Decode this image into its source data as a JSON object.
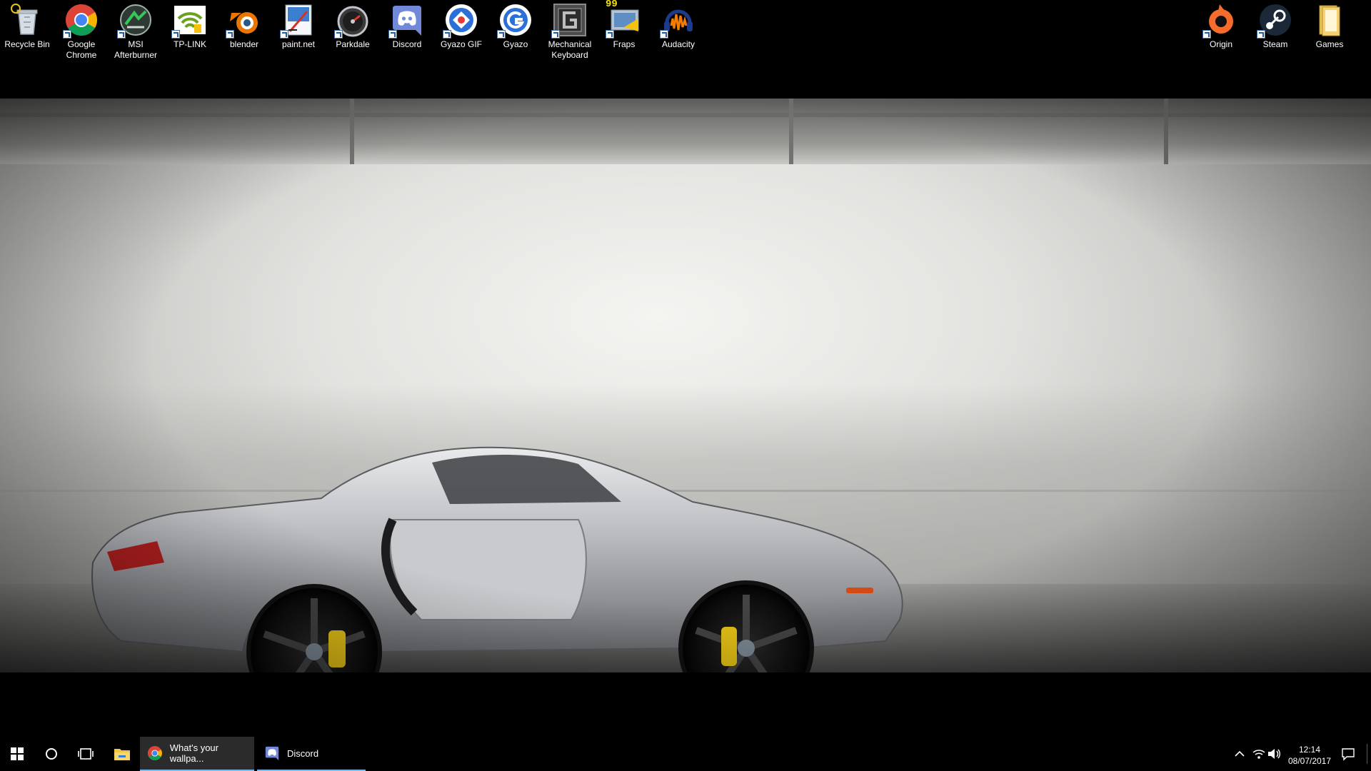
{
  "desktop_icons": [
    {
      "label": "Recycle Bin",
      "icon": "recycle-bin-icon"
    },
    {
      "label": "Google Chrome",
      "icon": "chrome-icon"
    },
    {
      "label": "MSI Afterburner",
      "icon": "msi-afterburner-icon"
    },
    {
      "label": "TP-LINK",
      "icon": "tp-link-icon"
    },
    {
      "label": "blender",
      "icon": "blender-icon"
    },
    {
      "label": "paint.net",
      "icon": "paint-net-icon"
    },
    {
      "label": "Parkdale",
      "icon": "parkdale-icon"
    },
    {
      "label": "Discord",
      "icon": "discord-icon"
    },
    {
      "label": "Gyazo GIF",
      "icon": "gyazo-gif-icon"
    },
    {
      "label": "Gyazo",
      "icon": "gyazo-icon"
    },
    {
      "label": "Mechanical Keyboard",
      "icon": "mechanical-keyboard-icon"
    },
    {
      "label": "Fraps",
      "icon": "fraps-icon"
    },
    {
      "label": "Audacity",
      "icon": "audacity-icon"
    },
    {
      "label": "Origin",
      "icon": "origin-icon"
    },
    {
      "label": "Steam",
      "icon": "steam-icon"
    },
    {
      "label": "Games",
      "icon": "folder-icon"
    }
  ],
  "fraps_overlay": "99",
  "wallpaper": {
    "subject": "silver-sports-car",
    "accent_caliper": "#e8c416"
  },
  "taskbar": {
    "apps": [
      {
        "label": "What's your wallpa...",
        "icon": "chrome-icon",
        "active": true
      },
      {
        "label": "Discord",
        "icon": "discord-icon",
        "active": false
      }
    ],
    "clock": {
      "time": "12:14",
      "date": "08/07/2017"
    },
    "accent": "#76b9ed"
  }
}
